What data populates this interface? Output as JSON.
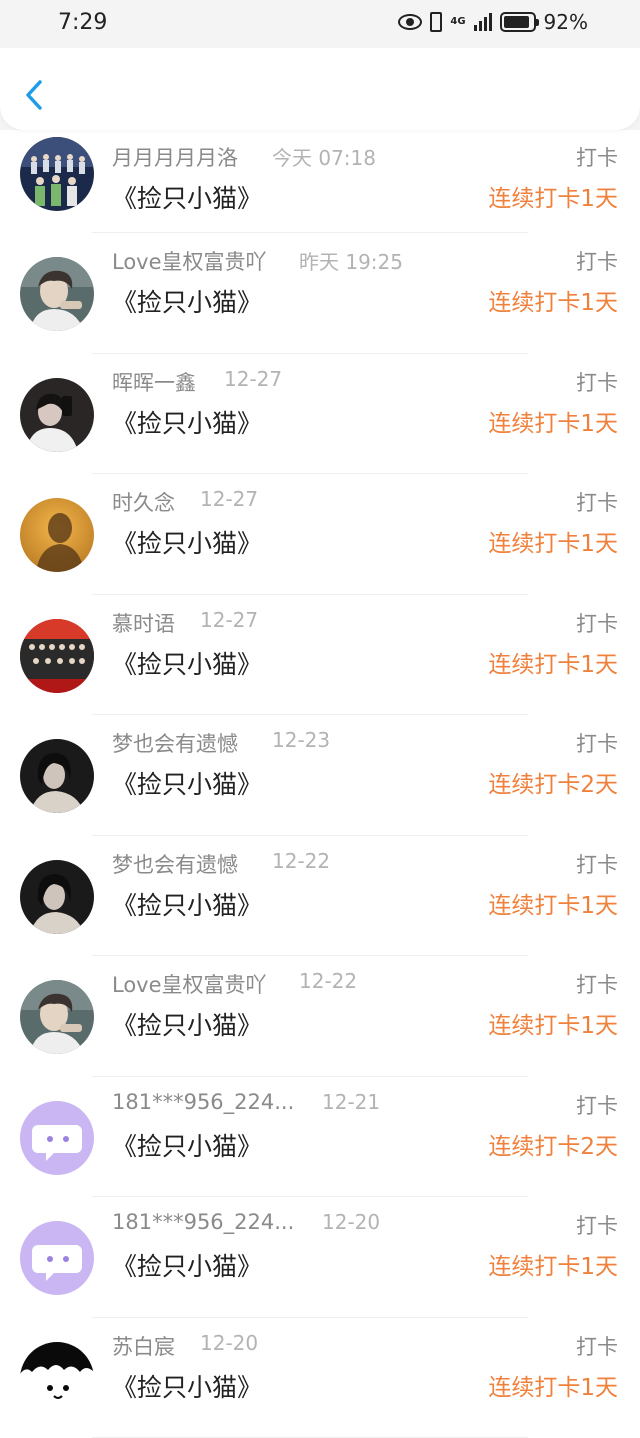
{
  "status": {
    "time": "7:29",
    "network": "4G",
    "battery": "92%"
  },
  "header": {
    "back_icon": "chevron-left-icon",
    "accent_color": "#1e9be9"
  },
  "colors": {
    "streak": "#f0813c",
    "name": "#8a8a8a",
    "date": "#b3b3b3"
  },
  "records": [
    {
      "name": "月月月月月洛",
      "date": "今天 07:18",
      "book": "《捡只小猫》",
      "type": "打卡",
      "streak": "连续打卡1天",
      "avatar": "group-photo"
    },
    {
      "name": "Love皇权富贵吖",
      "date": "昨天 19:25",
      "book": "《捡只小猫》",
      "type": "打卡",
      "streak": "连续打卡1天",
      "avatar": "boy-photo"
    },
    {
      "name": "晖晖一鑫",
      "date": "12-27",
      "book": "《捡只小猫》",
      "type": "打卡",
      "streak": "连续打卡1天",
      "avatar": "mirror-selfie"
    },
    {
      "name": "时久念",
      "date": "12-27",
      "book": "《捡只小猫》",
      "type": "打卡",
      "streak": "连续打卡1天",
      "avatar": "silhouette-orange"
    },
    {
      "name": "慕时语",
      "date": "12-27",
      "book": "《捡只小猫》",
      "type": "打卡",
      "streak": "连续打卡1天",
      "avatar": "stage-group"
    },
    {
      "name": "梦也会有遗憾",
      "date": "12-23",
      "book": "《捡只小猫》",
      "type": "打卡",
      "streak": "连续打卡2天",
      "avatar": "girl-dark"
    },
    {
      "name": "梦也会有遗憾",
      "date": "12-22",
      "book": "《捡只小猫》",
      "type": "打卡",
      "streak": "连续打卡1天",
      "avatar": "girl-dark"
    },
    {
      "name": "Love皇权富贵吖",
      "date": "12-22",
      "book": "《捡只小猫》",
      "type": "打卡",
      "streak": "连续打卡1天",
      "avatar": "boy-photo"
    },
    {
      "name": "181***956_224...",
      "date": "12-21",
      "book": "《捡只小猫》",
      "type": "打卡",
      "streak": "连续打卡2天",
      "avatar": "default-chat"
    },
    {
      "name": "181***956_224...",
      "date": "12-20",
      "book": "《捡只小猫》",
      "type": "打卡",
      "streak": "连续打卡1天",
      "avatar": "default-chat"
    },
    {
      "name": "苏白宸",
      "date": "12-20",
      "book": "《捡只小猫》",
      "type": "打卡",
      "streak": "连续打卡1天",
      "avatar": "cartoon-face"
    }
  ]
}
